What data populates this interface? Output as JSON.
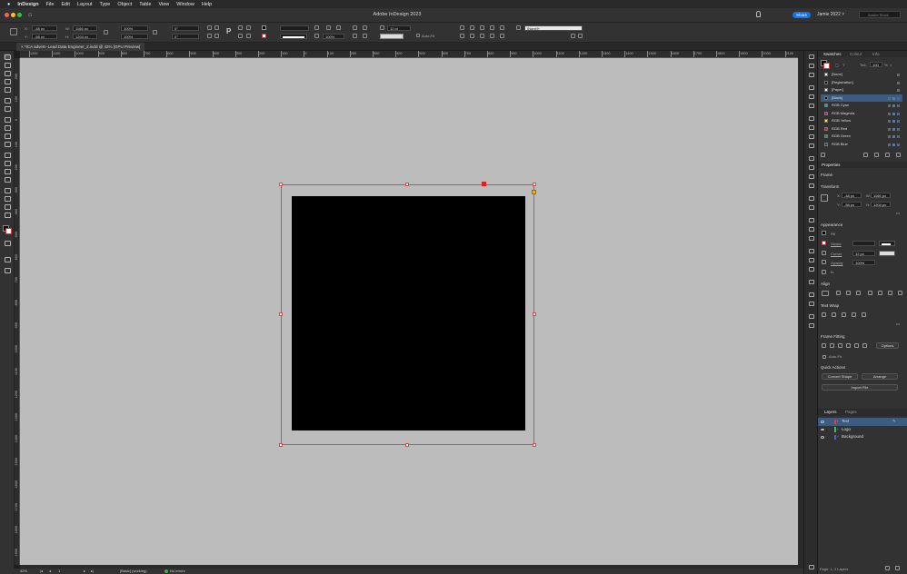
{
  "menubar": {
    "apple": "",
    "app": "InDesign",
    "items": [
      "File",
      "Edit",
      "Layout",
      "Type",
      "Object",
      "Table",
      "View",
      "Window",
      "Help"
    ]
  },
  "appbar": {
    "title": "Adobe InDesign 2023",
    "share_label": "Share",
    "workspace": "Jamie 2022",
    "stock_placeholder": "Adobe Stock"
  },
  "control": {
    "x_label": "X:",
    "x_value": "-48 px",
    "y_label": "Y:",
    "y_value": "-58 px",
    "w_label": "W:",
    "w_value": "1166 px",
    "h_label": "H:",
    "h_value": "1204 px",
    "scale_x": "100%",
    "scale_y": "100%",
    "angle": "0°",
    "shear": "0°",
    "stroke_weight": "12 pt",
    "opacity": "100%",
    "style_select": "[None]+",
    "autofit_label": "Auto-Fit"
  },
  "document_tab": {
    "label": "*ICA advert--Lead Data Engineer_2.indd @ 42% [GPU Preview]"
  },
  "hruler": {
    "labels": [
      "1200",
      "1100",
      "1000",
      "900",
      "800",
      "700",
      "600",
      "500",
      "400",
      "300",
      "200",
      "100",
      "0",
      "100",
      "200",
      "300",
      "400",
      "500",
      "600",
      "700",
      "800",
      "900",
      "1000",
      "1100",
      "1200",
      "1300",
      "1400",
      "1500",
      "1600",
      "1700",
      "1800",
      "1900",
      "2000",
      "2100"
    ]
  },
  "vruler": {
    "labels": [
      "200",
      "100",
      "0",
      "100",
      "200",
      "300",
      "400",
      "500",
      "600",
      "700",
      "800",
      "900",
      "1000",
      "1100",
      "1200",
      "1300",
      "1400",
      "1500",
      "1600",
      "1700",
      "1800",
      "1900"
    ]
  },
  "status": {
    "zoom": "42%",
    "page": "1",
    "profile": "[Basic] (working)",
    "errors": "No errors"
  },
  "swatches_panel": {
    "tabs": [
      "Swatches",
      "Colour",
      "Info"
    ],
    "tint_label": "Tint:",
    "tint_value": "100",
    "tint_unit": "%",
    "items": [
      {
        "name": "[None]",
        "color": "#ffffff"
      },
      {
        "name": "[Registration]",
        "color": "#000000"
      },
      {
        "name": "[Paper]",
        "color": "#ffffff"
      },
      {
        "name": "[Black]",
        "color": "#000000"
      },
      {
        "name": "RGB Cyan",
        "color": "#00aeef"
      },
      {
        "name": "RGB Magenta",
        "color": "#ec008c"
      },
      {
        "name": "RGB Yellow",
        "color": "#fff200"
      },
      {
        "name": "RGB Red",
        "color": "#ed1c24"
      },
      {
        "name": "RGB Green",
        "color": "#00a651"
      },
      {
        "name": "RGB Blue",
        "color": "#2e3192"
      }
    ],
    "selected_index": 3
  },
  "properties_panel": {
    "title": "Properties",
    "frame_label": "Frame",
    "transform_label": "Transform",
    "x_label": "X:",
    "x_value": "-48 px",
    "y_label": "Y:",
    "y_value": "-58 px",
    "w_label": "W:",
    "w_value": "1166 px",
    "h_label": "H:",
    "h_value": "1204 px",
    "appearance_label": "Appearance",
    "fill_label": "Fill",
    "stroke_label": "Stroke",
    "corner_label": "Corner",
    "corner_value": "12 px",
    "opacity_label": "Opacity",
    "opacity_value": "100%",
    "fx_label": "fx.",
    "align_label": "Align",
    "textwrap_label": "Text Wrap",
    "framefitting_label": "Frame Fitting",
    "options_button": "Options",
    "autofit_label": "Auto-Fit",
    "quickactions_label": "Quick Actions",
    "convert_shape": "Convert Shape",
    "arrange": "Arrange",
    "import_file": "Import File"
  },
  "layers_panel": {
    "tabs": [
      "Layers",
      "Pages"
    ],
    "items": [
      {
        "name": "Text",
        "color": "#e04040"
      },
      {
        "name": "Logo",
        "color": "#40c040"
      },
      {
        "name": "Background",
        "color": "#4060e0"
      }
    ],
    "footer": "Page: 1, 3 Layers"
  }
}
